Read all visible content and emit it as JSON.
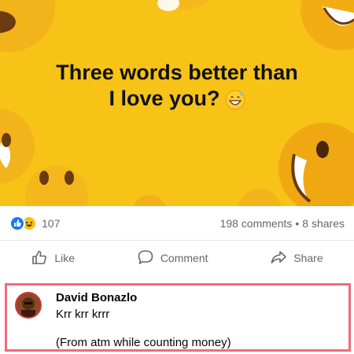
{
  "post": {
    "headline_line1": "Three words better than",
    "headline_line2": "I love you?",
    "headline_emoji": "grinning-sweat-emoji",
    "background_color": "#f7c316"
  },
  "stats": {
    "reaction_icons": [
      "like-reaction-icon",
      "haha-reaction-icon"
    ],
    "reaction_count": "107",
    "comments": "198 comments",
    "separator": "•",
    "shares": "8 shares"
  },
  "actions": {
    "like_label": "Like",
    "comment_label": "Comment",
    "share_label": "Share"
  },
  "comment": {
    "author": "David Bonazlo",
    "line1": "Krr krr krrr",
    "line2": "(From atm while counting money)",
    "highlight_color": "#ee6b7c"
  },
  "colors": {
    "like_blue": "#1877f2",
    "secondary_text": "#65676b"
  }
}
